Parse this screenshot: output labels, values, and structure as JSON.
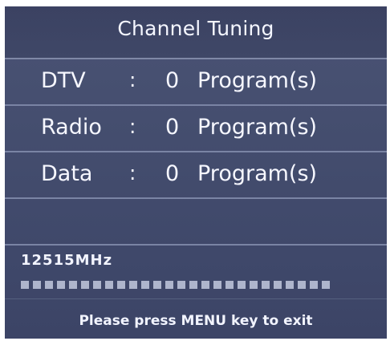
{
  "dialog": {
    "title": "Channel Tuning",
    "rows": [
      {
        "label": "DTV",
        "separator": ":",
        "count": "0",
        "unit": "Program(s)"
      },
      {
        "label": "Radio",
        "separator": ":",
        "count": "0",
        "unit": "Program(s)"
      },
      {
        "label": "Data",
        "separator": ":",
        "count": "0",
        "unit": "Program(s)"
      }
    ],
    "frequency": "12515MHz",
    "progress": {
      "segments": 26,
      "filled": 26
    },
    "hint": "Please press MENU key to exit"
  },
  "colors": {
    "background": "#444d6e",
    "separator": "#7a84a4",
    "text": "#f6f7ff",
    "progress_segment": "#aeb5cc"
  }
}
